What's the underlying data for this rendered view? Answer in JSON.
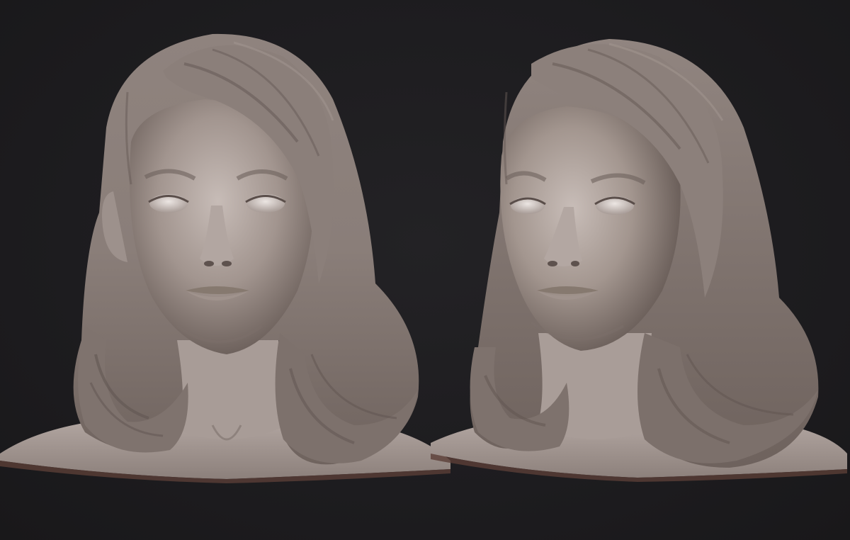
{
  "scene": {
    "background": "#1c1b1d",
    "material_color": "#9a8e89",
    "highlight_color": "#c9bfba",
    "shadow_color": "#4f4642"
  },
  "renders": [
    {
      "view": "front"
    },
    {
      "view": "three-quarter"
    }
  ]
}
